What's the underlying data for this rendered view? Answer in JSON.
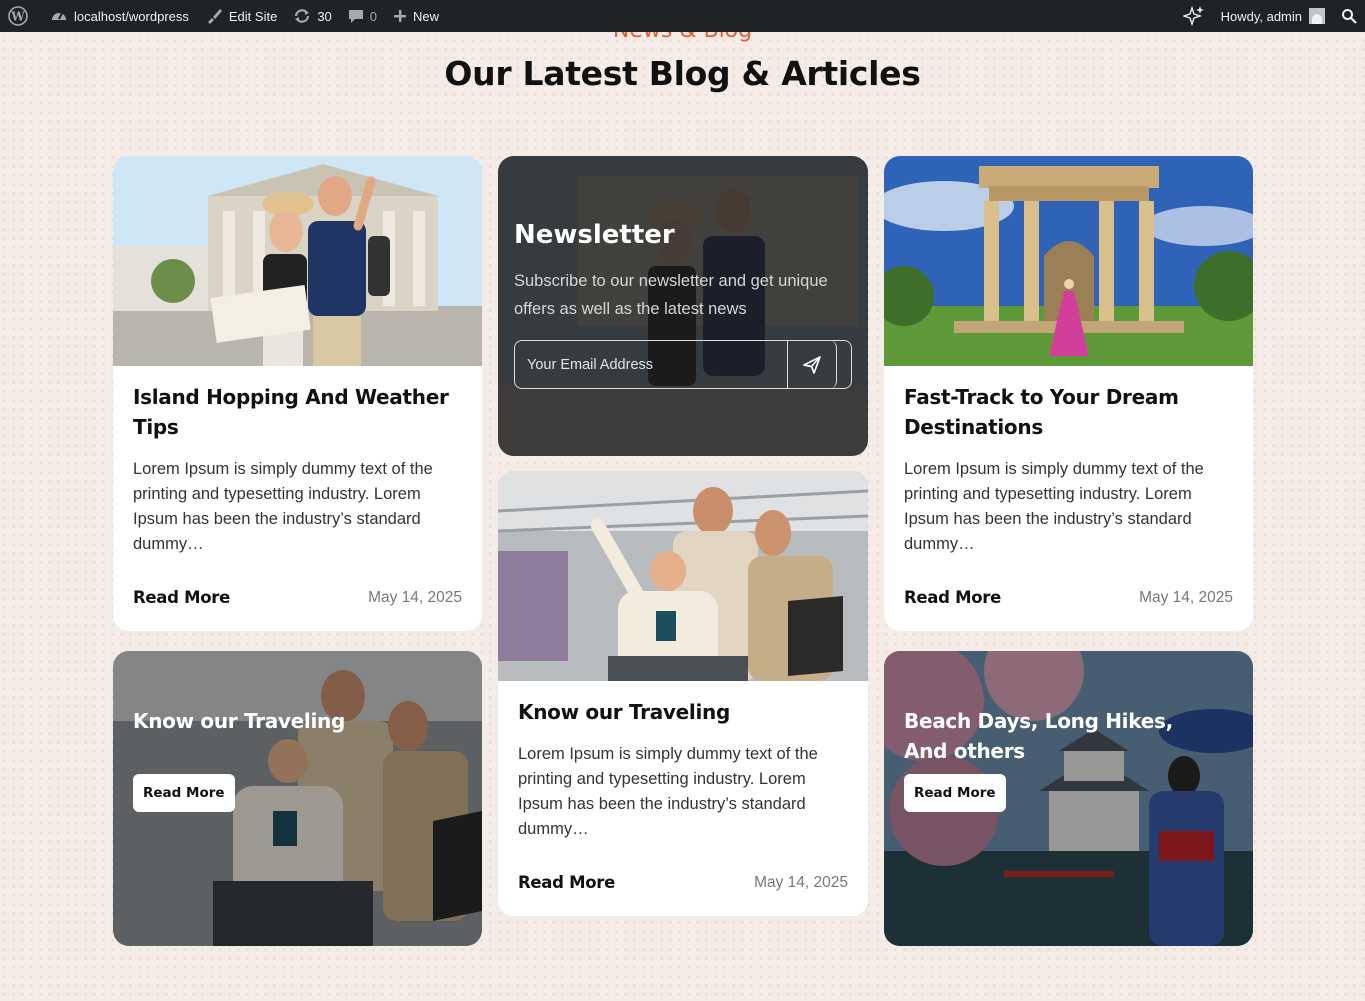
{
  "adminbar": {
    "site": "localhost/wordpress",
    "edit_site": "Edit Site",
    "updates": "30",
    "comments": "0",
    "new": "New",
    "howdy": "Howdy, admin"
  },
  "section": {
    "eyebrow": "News & Blog",
    "title": "Our Latest Blog & Articles"
  },
  "newsletter": {
    "title": "Newsletter",
    "text": "Subscribe to our newsletter and get unique offers as well as the latest news",
    "placeholder": "Your Email Address"
  },
  "cards": [
    {
      "title": "Island Hopping And Weather Tips",
      "excerpt": "Lorem Ipsum is simply dummy text of the printing and typesetting industry. Lorem Ipsum has been the industry’s standard dummy…",
      "read_more": "Read More",
      "date": "May 14, 2025"
    },
    {
      "title": "Fast-Track to Your Dream Destinations",
      "excerpt": "Lorem Ipsum is simply dummy text of the printing and typesetting industry. Lorem Ipsum has been the industry’s standard dummy…",
      "read_more": "Read More",
      "date": "May 14, 2025"
    },
    {
      "title": "Know our Traveling",
      "excerpt": "Lorem Ipsum is simply dummy text of the printing and typesetting industry. Lorem Ipsum has been the industry’s standard dummy…",
      "read_more": "Read More",
      "date": "May 14, 2025"
    }
  ],
  "overlay_cards": [
    {
      "title": "Know our Traveling",
      "read_more": "Read More"
    },
    {
      "title": "Beach Days, Long Hikes, And others",
      "read_more": "Read More"
    }
  ],
  "colors": {
    "accent": "#e9602e",
    "adminbar": "#1d2327",
    "page_bg": "#f5ece8"
  }
}
